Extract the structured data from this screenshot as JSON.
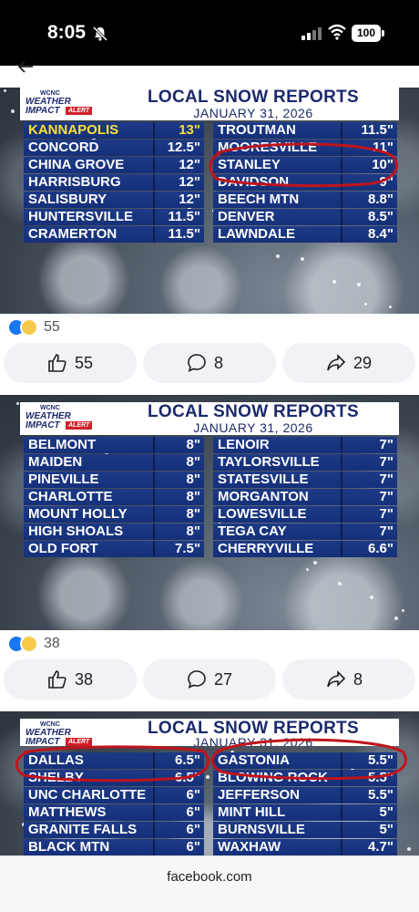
{
  "status_bar": {
    "time": "8:05",
    "battery": "100"
  },
  "posts": [
    {
      "title": "LOCAL SNOW REPORTS",
      "date": "JANUARY 31, 2026",
      "left": [
        {
          "name": "KANNAPOLIS",
          "value": "13\"",
          "highlight": true
        },
        {
          "name": "CONCORD",
          "value": "12.5\""
        },
        {
          "name": "CHINA GROVE",
          "value": "12\""
        },
        {
          "name": "HARRISBURG",
          "value": "12\""
        },
        {
          "name": "SALISBURY",
          "value": "12\""
        },
        {
          "name": "HUNTERSVILLE",
          "value": "11.5\""
        },
        {
          "name": "CRAMERTON",
          "value": "11.5\""
        }
      ],
      "right": [
        {
          "name": "TROUTMAN",
          "value": "11.5\""
        },
        {
          "name": "MOORESVILLE",
          "value": "11\""
        },
        {
          "name": "STANLEY",
          "value": "10\""
        },
        {
          "name": "DAVIDSON",
          "value": "9\""
        },
        {
          "name": "BEECH MTN",
          "value": "8.8\""
        },
        {
          "name": "DENVER",
          "value": "8.5\""
        },
        {
          "name": "LAWNDALE",
          "value": "8.4\""
        }
      ],
      "reactions": "55",
      "likes": "55",
      "comments": "8",
      "shares": "29"
    },
    {
      "title": "LOCAL SNOW REPORTS",
      "date": "JANUARY 31, 2026",
      "left": [
        {
          "name": "BELMONT",
          "value": "8\""
        },
        {
          "name": "MAIDEN",
          "value": "8\""
        },
        {
          "name": "PINEVILLE",
          "value": "8\""
        },
        {
          "name": "CHARLOTTE",
          "value": "8\""
        },
        {
          "name": "MOUNT HOLLY",
          "value": "8\""
        },
        {
          "name": "HIGH SHOALS",
          "value": "8\""
        },
        {
          "name": "OLD FORT",
          "value": "7.5\""
        }
      ],
      "right": [
        {
          "name": "LENOIR",
          "value": "7\""
        },
        {
          "name": "TAYLORSVILLE",
          "value": "7\""
        },
        {
          "name": "STATESVILLE",
          "value": "7\""
        },
        {
          "name": "MORGANTON",
          "value": "7\""
        },
        {
          "name": "LOWESVILLE",
          "value": "7\""
        },
        {
          "name": "TEGA CAY",
          "value": "7\""
        },
        {
          "name": "CHERRYVILLE",
          "value": "6.6\""
        }
      ],
      "reactions": "38",
      "likes": "38",
      "comments": "27",
      "shares": "8"
    },
    {
      "title": "LOCAL SNOW REPORTS",
      "date": "JANUARY 31, 2026",
      "left": [
        {
          "name": "DALLAS",
          "value": "6.5\""
        },
        {
          "name": "SHELBY",
          "value": "6.5\""
        },
        {
          "name": "UNC CHARLOTTE",
          "value": "6\""
        },
        {
          "name": "MATTHEWS",
          "value": "6\""
        },
        {
          "name": "GRANITE FALLS",
          "value": "6\""
        },
        {
          "name": "BLACK MTN",
          "value": "6\""
        }
      ],
      "right": [
        {
          "name": "GASTONIA",
          "value": "5.5\""
        },
        {
          "name": "BLOWING ROCK",
          "value": "5.5\""
        },
        {
          "name": "JEFFERSON",
          "value": "5.5\""
        },
        {
          "name": "MINT HILL",
          "value": "5\""
        },
        {
          "name": "BURNSVILLE",
          "value": "5\""
        },
        {
          "name": "WAXHAW",
          "value": "4.7\""
        }
      ]
    }
  ],
  "logo": {
    "station": "WCNC",
    "line1": "WEATHER",
    "line2": "IMPACT",
    "badge": "ALERT"
  },
  "bottom": {
    "url": "facebook.com"
  },
  "colors": {
    "annotation": "#c0141c",
    "row": "#1d3a86",
    "highlight": "#ffe034",
    "like": "#1877f2"
  }
}
